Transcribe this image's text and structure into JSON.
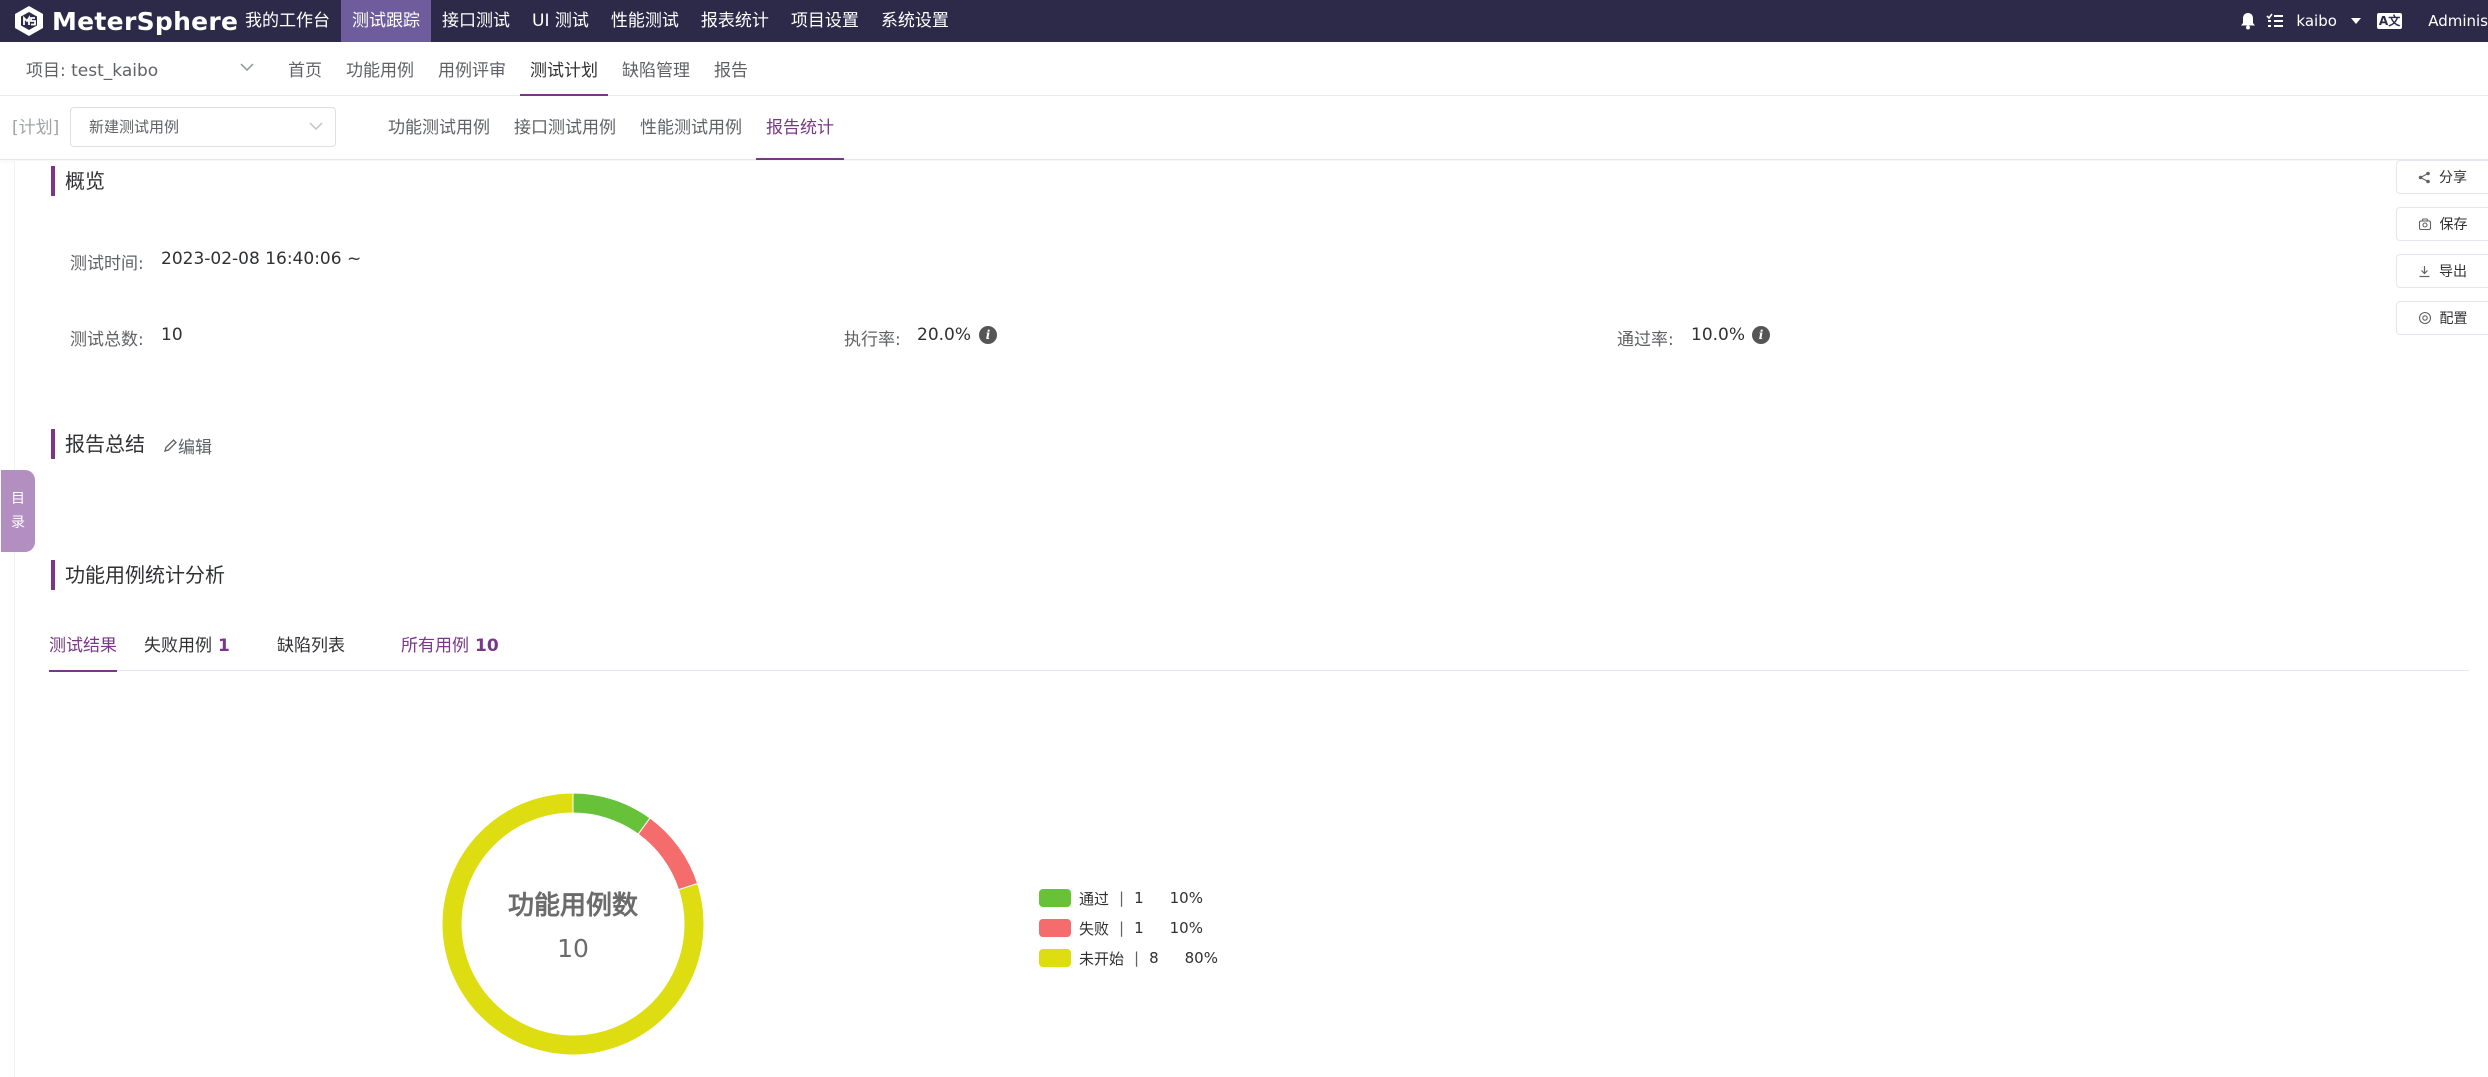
{
  "app": {
    "name": "MeterSphere"
  },
  "topnav": {
    "items": [
      {
        "label": "我的工作台",
        "active": false
      },
      {
        "label": "测试跟踪",
        "active": true
      },
      {
        "label": "接口测试",
        "active": false
      },
      {
        "label": "UI 测试",
        "active": false
      },
      {
        "label": "性能测试",
        "active": false
      },
      {
        "label": "报表统计",
        "active": false
      },
      {
        "label": "项目设置",
        "active": false
      },
      {
        "label": "系统设置",
        "active": false
      }
    ]
  },
  "user": {
    "name": "kaibo",
    "lang_icon": "A文",
    "org": "Adminis"
  },
  "project": {
    "label": "项目: test_kaibo"
  },
  "subnav": {
    "items": [
      {
        "label": "首页",
        "active": false
      },
      {
        "label": "功能用例",
        "active": false
      },
      {
        "label": "用例评审",
        "active": false
      },
      {
        "label": "测试计划",
        "active": true
      },
      {
        "label": "缺陷管理",
        "active": false
      },
      {
        "label": "报告",
        "active": false
      }
    ]
  },
  "plan": {
    "tag": "[计划]",
    "selected": "新建测试用例"
  },
  "plan_tabs": {
    "items": [
      {
        "label": "功能测试用例",
        "active": false
      },
      {
        "label": "接口测试用例",
        "active": false
      },
      {
        "label": "性能测试用例",
        "active": false
      },
      {
        "label": "报告统计",
        "active": true
      }
    ]
  },
  "overview": {
    "title": "概览",
    "test_time_label": "测试时间:",
    "test_time_value": "2023-02-08 16:40:06 ~",
    "total_label": "测试总数:",
    "total_value": "10",
    "exec_rate_label": "执行率:",
    "exec_rate_value": "20.0%",
    "pass_rate_label": "通过率:",
    "pass_rate_value": "10.0%"
  },
  "summary": {
    "title": "报告总结",
    "edit_label": "编辑"
  },
  "analysis": {
    "title": "功能用例统计分析",
    "tabs": [
      {
        "label": "测试结果",
        "count": "",
        "active": true
      },
      {
        "label": "失败用例",
        "count": "1",
        "active": false
      },
      {
        "label": "缺陷列表",
        "count": "",
        "active": false
      },
      {
        "label": "所有用例",
        "count": "10",
        "active": false
      }
    ]
  },
  "chart_data": {
    "type": "pie",
    "title": "功能用例数",
    "total": "10",
    "slices": [
      {
        "name": "通过",
        "count": "1",
        "percent": "10%",
        "value": 1,
        "color": "#67c23a"
      },
      {
        "name": "失败",
        "count": "1",
        "percent": "10%",
        "value": 1,
        "color": "#f56c6c"
      },
      {
        "name": "未开始",
        "count": "8",
        "percent": "80%",
        "value": 8,
        "color": "#dddd11"
      }
    ]
  },
  "side_actions": [
    {
      "label": "分享",
      "icon": "share-icon"
    },
    {
      "label": "保存",
      "icon": "save-icon"
    },
    {
      "label": "导出",
      "icon": "download-icon"
    },
    {
      "label": "配置",
      "icon": "gear-icon"
    }
  ],
  "toc": {
    "line1": "目",
    "line2": "录"
  }
}
